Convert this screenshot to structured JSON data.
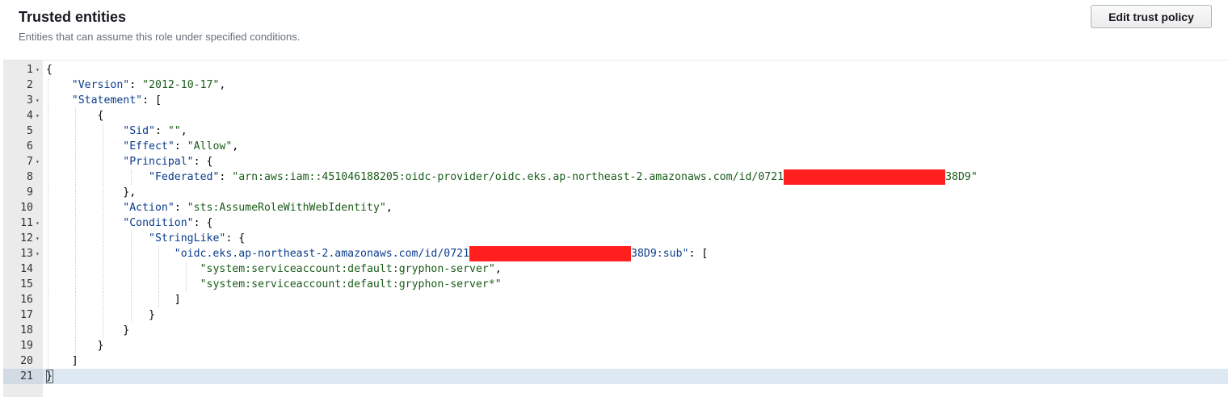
{
  "panel": {
    "title": "Trusted entities",
    "subtitle": "Entities that can assume this role under specified conditions.",
    "edit_button_label": "Edit trust policy"
  },
  "editor": {
    "lines": [
      {
        "num": "1",
        "fold": true,
        "indent": 0,
        "tokens": [
          {
            "t": "p",
            "v": "{"
          }
        ]
      },
      {
        "num": "2",
        "fold": false,
        "indent": 1,
        "tokens": [
          {
            "t": "k",
            "v": "\"Version\""
          },
          {
            "t": "p",
            "v": ": "
          },
          {
            "t": "s",
            "v": "\"2012-10-17\""
          },
          {
            "t": "p",
            "v": ","
          }
        ]
      },
      {
        "num": "3",
        "fold": true,
        "indent": 1,
        "tokens": [
          {
            "t": "k",
            "v": "\"Statement\""
          },
          {
            "t": "p",
            "v": ": ["
          }
        ]
      },
      {
        "num": "4",
        "fold": true,
        "indent": 2,
        "tokens": [
          {
            "t": "p",
            "v": "{"
          }
        ]
      },
      {
        "num": "5",
        "fold": false,
        "indent": 3,
        "tokens": [
          {
            "t": "k",
            "v": "\"Sid\""
          },
          {
            "t": "p",
            "v": ": "
          },
          {
            "t": "s",
            "v": "\"\""
          },
          {
            "t": "p",
            "v": ","
          }
        ]
      },
      {
        "num": "6",
        "fold": false,
        "indent": 3,
        "tokens": [
          {
            "t": "k",
            "v": "\"Effect\""
          },
          {
            "t": "p",
            "v": ": "
          },
          {
            "t": "s",
            "v": "\"Allow\""
          },
          {
            "t": "p",
            "v": ","
          }
        ]
      },
      {
        "num": "7",
        "fold": true,
        "indent": 3,
        "tokens": [
          {
            "t": "k",
            "v": "\"Principal\""
          },
          {
            "t": "p",
            "v": ": {"
          }
        ]
      },
      {
        "num": "8",
        "fold": false,
        "indent": 4,
        "tokens": [
          {
            "t": "k",
            "v": "\"Federated\""
          },
          {
            "t": "p",
            "v": ": "
          },
          {
            "t": "s",
            "v": "\"arn:aws:iam::451046188205:oidc-provider/oidc.eks.ap-northeast-2.amazonaws.com/id/0721"
          },
          {
            "t": "r",
            "v": "200"
          },
          {
            "t": "s",
            "v": "38D9\""
          }
        ]
      },
      {
        "num": "9",
        "fold": false,
        "indent": 3,
        "tokens": [
          {
            "t": "p",
            "v": "},"
          }
        ]
      },
      {
        "num": "10",
        "fold": false,
        "indent": 3,
        "tokens": [
          {
            "t": "k",
            "v": "\"Action\""
          },
          {
            "t": "p",
            "v": ": "
          },
          {
            "t": "s",
            "v": "\"sts:AssumeRoleWithWebIdentity\""
          },
          {
            "t": "p",
            "v": ","
          }
        ]
      },
      {
        "num": "11",
        "fold": true,
        "indent": 3,
        "tokens": [
          {
            "t": "k",
            "v": "\"Condition\""
          },
          {
            "t": "p",
            "v": ": {"
          }
        ]
      },
      {
        "num": "12",
        "fold": true,
        "indent": 4,
        "tokens": [
          {
            "t": "k",
            "v": "\"StringLike\""
          },
          {
            "t": "p",
            "v": ": {"
          }
        ]
      },
      {
        "num": "13",
        "fold": true,
        "indent": 5,
        "tokens": [
          {
            "t": "k",
            "v": "\"oidc.eks.ap-northeast-2.amazonaws.com/id/0721"
          },
          {
            "t": "r",
            "v": "200"
          },
          {
            "t": "k",
            "v": "38D9:sub\""
          },
          {
            "t": "p",
            "v": ": ["
          }
        ]
      },
      {
        "num": "14",
        "fold": false,
        "indent": 6,
        "tokens": [
          {
            "t": "s",
            "v": "\"system:serviceaccount:default:gryphon-server\""
          },
          {
            "t": "p",
            "v": ","
          }
        ]
      },
      {
        "num": "15",
        "fold": false,
        "indent": 6,
        "tokens": [
          {
            "t": "s",
            "v": "\"system:serviceaccount:default:gryphon-server*\""
          }
        ]
      },
      {
        "num": "16",
        "fold": false,
        "indent": 5,
        "tokens": [
          {
            "t": "p",
            "v": "]"
          }
        ]
      },
      {
        "num": "17",
        "fold": false,
        "indent": 4,
        "tokens": [
          {
            "t": "p",
            "v": "}"
          }
        ]
      },
      {
        "num": "18",
        "fold": false,
        "indent": 3,
        "tokens": [
          {
            "t": "p",
            "v": "}"
          }
        ]
      },
      {
        "num": "19",
        "fold": false,
        "indent": 2,
        "tokens": [
          {
            "t": "p",
            "v": "}"
          }
        ]
      },
      {
        "num": "20",
        "fold": false,
        "indent": 1,
        "tokens": [
          {
            "t": "p",
            "v": "]"
          }
        ]
      },
      {
        "num": "21",
        "fold": false,
        "indent": 0,
        "tokens": [
          {
            "t": "p",
            "v": "}"
          }
        ]
      }
    ],
    "active_line": "21",
    "colors": {
      "key": "#0a3c8c",
      "string": "#1a5c1a",
      "redaction": "#ff1f1f",
      "gutter": "#ebebeb",
      "active_line": "#dde8f3"
    }
  }
}
